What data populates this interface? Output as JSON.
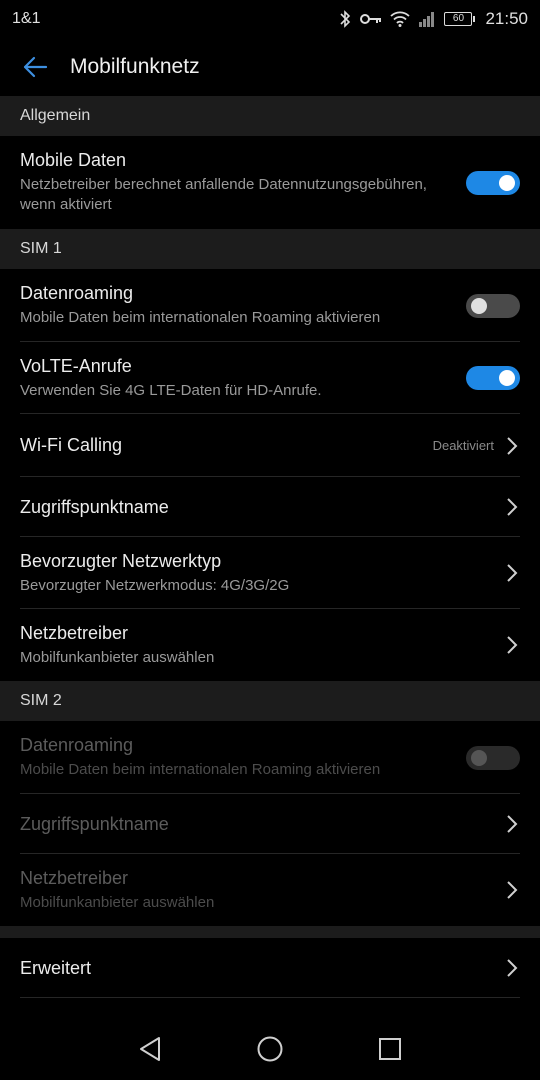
{
  "status": {
    "carrier": "1&1",
    "battery": "60",
    "time": "21:50"
  },
  "header": {
    "title": "Mobilfunknetz"
  },
  "sections": {
    "general": {
      "label": "Allgemein"
    },
    "sim1": {
      "label": "SIM 1"
    },
    "sim2": {
      "label": "SIM 2"
    }
  },
  "items": {
    "mobile_data": {
      "title": "Mobile Daten",
      "subtitle": "Netzbetreiber berechnet anfallende Datennutzungsgebühren, wenn aktiviert",
      "enabled": true
    },
    "sim1_roaming": {
      "title": "Datenroaming",
      "subtitle": "Mobile Daten beim internationalen Roaming aktivieren",
      "enabled": false
    },
    "volte": {
      "title": "VoLTE-Anrufe",
      "subtitle": "Verwenden Sie 4G LTE-Daten für HD-Anrufe.",
      "enabled": true
    },
    "wifi_calling": {
      "title": "Wi-Fi Calling",
      "value": "Deaktiviert"
    },
    "sim1_apn": {
      "title": "Zugriffspunktname"
    },
    "network_type": {
      "title": "Bevorzugter Netzwerktyp",
      "subtitle": "Bevorzugter Netzwerkmodus: 4G/3G/2G"
    },
    "sim1_operator": {
      "title": "Netzbetreiber",
      "subtitle": "Mobilfunkanbieter auswählen"
    },
    "sim2_roaming": {
      "title": "Datenroaming",
      "subtitle": "Mobile Daten beim internationalen Roaming aktivieren",
      "enabled": false
    },
    "sim2_apn": {
      "title": "Zugriffspunktname"
    },
    "sim2_operator": {
      "title": "Netzbetreiber",
      "subtitle": "Mobilfunkanbieter auswählen"
    },
    "advanced": {
      "title": "Erweitert"
    }
  },
  "icons": {
    "back": "arrow-left-icon",
    "chevron": "chevron-right-icon",
    "nav_back": "triangle-back-icon",
    "nav_home": "circle-home-icon",
    "nav_recent": "square-recents-icon"
  },
  "colors": {
    "accent": "#1e88e5",
    "background": "#000000",
    "section": "#1c1c1c"
  }
}
